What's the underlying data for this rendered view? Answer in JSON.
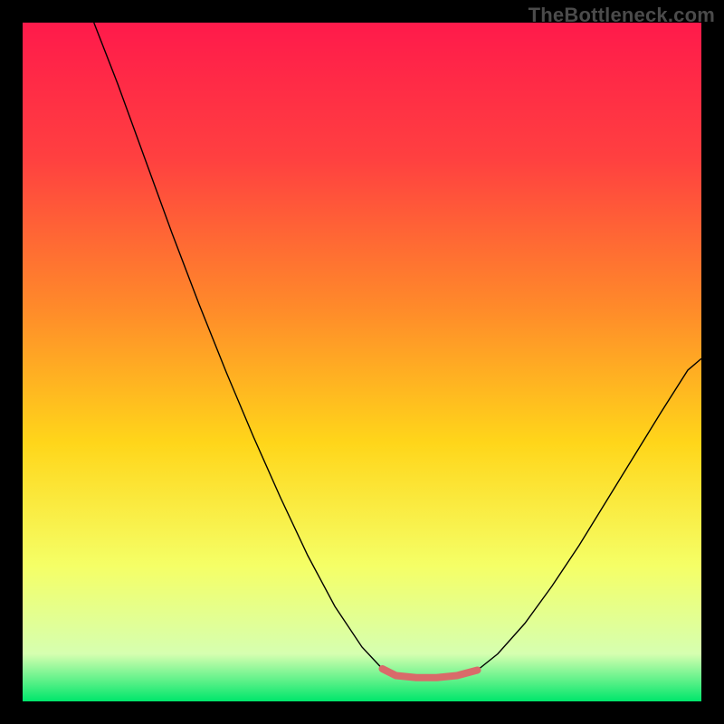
{
  "watermark": {
    "text": "TheBottleneck.com"
  },
  "chart_data": {
    "type": "line",
    "title": "",
    "xlabel": "",
    "ylabel": "",
    "xlim": [
      0,
      100
    ],
    "ylim": [
      0,
      100
    ],
    "grid": false,
    "legend": false,
    "background_gradient": {
      "stops": [
        {
          "offset": 0.0,
          "color": "#ff1a4b"
        },
        {
          "offset": 0.2,
          "color": "#ff4040"
        },
        {
          "offset": 0.42,
          "color": "#ff8a2a"
        },
        {
          "offset": 0.62,
          "color": "#ffd61a"
        },
        {
          "offset": 0.8,
          "color": "#f5ff66"
        },
        {
          "offset": 0.93,
          "color": "#d6ffb0"
        },
        {
          "offset": 1.0,
          "color": "#00e66b"
        }
      ]
    },
    "series": [
      {
        "name": "bottleneck-curve",
        "color": "#000000",
        "width": 1.4,
        "points_xy": [
          [
            10.5,
            100.0
          ],
          [
            14.0,
            91.0
          ],
          [
            18.0,
            80.0
          ],
          [
            22.0,
            69.0
          ],
          [
            26.0,
            58.5
          ],
          [
            30.0,
            48.5
          ],
          [
            34.0,
            39.0
          ],
          [
            38.0,
            30.0
          ],
          [
            42.0,
            21.5
          ],
          [
            46.0,
            14.0
          ],
          [
            50.0,
            8.0
          ],
          [
            53.0,
            4.8
          ],
          [
            55.0,
            3.8
          ],
          [
            58.0,
            3.5
          ],
          [
            61.0,
            3.5
          ],
          [
            64.0,
            3.8
          ],
          [
            67.0,
            4.6
          ],
          [
            70.0,
            7.0
          ],
          [
            74.0,
            11.5
          ],
          [
            78.0,
            17.0
          ],
          [
            82.0,
            23.0
          ],
          [
            86.0,
            29.5
          ],
          [
            90.0,
            36.0
          ],
          [
            94.0,
            42.5
          ],
          [
            98.0,
            48.8
          ],
          [
            100.0,
            50.5
          ]
        ]
      },
      {
        "name": "optimal-zone-marker",
        "color": "#d96a6a",
        "width": 8,
        "linecap": "round",
        "points_xy": [
          [
            53.0,
            4.8
          ],
          [
            55.0,
            3.8
          ],
          [
            58.0,
            3.5
          ],
          [
            61.0,
            3.5
          ],
          [
            64.0,
            3.8
          ],
          [
            67.0,
            4.6
          ]
        ]
      }
    ]
  }
}
